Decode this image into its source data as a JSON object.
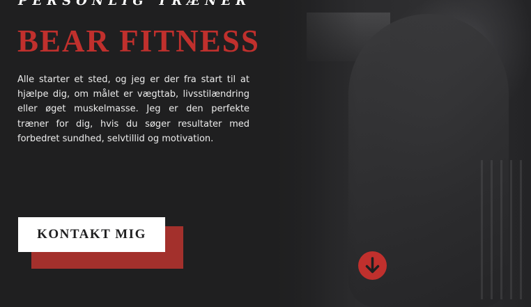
{
  "hero": {
    "subtitle": "PERSONLIG TRÆNER",
    "title": "BEAR FITNESS",
    "intro": "Alle starter et sted, og jeg er der fra start til at hjælpe dig, om målet er vægttab, livsstilændring eller øget muskelmasse. Jeg er den perfekte træner for dig, hvis du søger resultater med forbedret sundhed, selvtillid og motivation.",
    "cta_label": "KONTAKT MIG",
    "scroll_icon": "arrow-down-circle-icon"
  },
  "colors": {
    "background": "#1f1f20",
    "accent": "#c0302d",
    "accent_dark": "#a3302c",
    "text": "#ffffff"
  }
}
